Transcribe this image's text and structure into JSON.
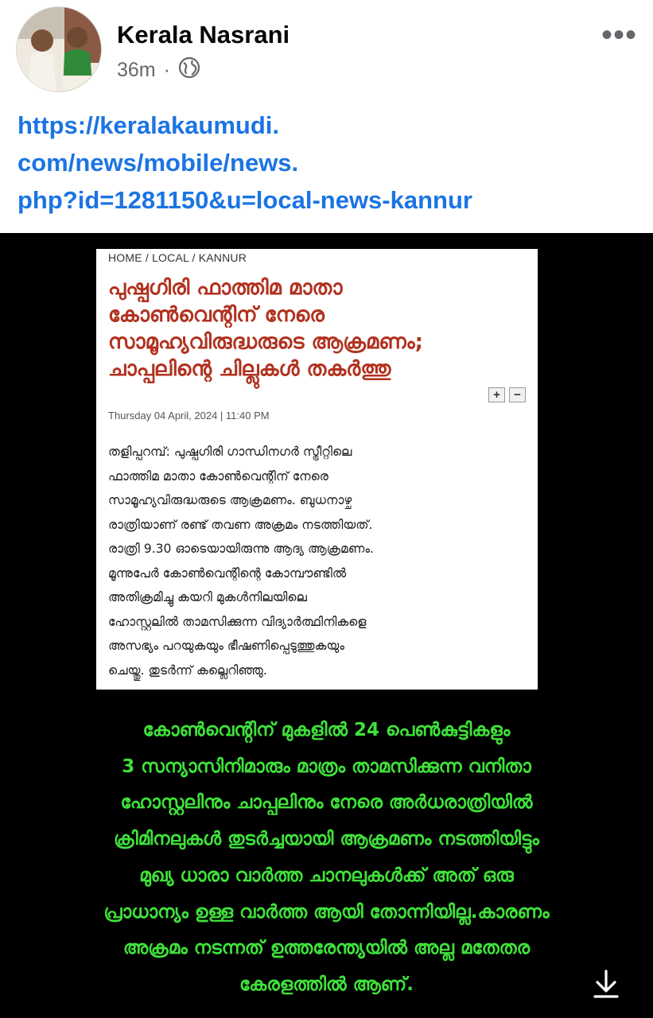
{
  "post": {
    "author": "Kerala Nasrani",
    "time": "36m",
    "separator": "·",
    "more_icon": "more-horizontal-icon",
    "privacy_icon": "globe-icon",
    "link_lines": [
      "https://keralakaumudi.",
      "com/news/mobile/news.",
      "php?id=1281150&u=local-news-kannur"
    ]
  },
  "article": {
    "breadcrumb": "HOME / LOCAL / KANNUR",
    "headline_lines": [
      "പുഷ്പഗിരി ഫാത്തിമ മാതാ",
      "കോൺവെന്റിന് നേരെ",
      "സാമൂഹ്യവിരുദ്ധരുടെ ആക്രമണം;",
      "ചാപ്പലിന്റെ ചില്ലുകൾ തകർത്തു"
    ],
    "zoom_in": "+",
    "zoom_out": "−",
    "dateline": "Thursday 04 April, 2024 | 11:40 PM",
    "body_lines": [
      "തളിപ്പറമ്പ്: പുഷ്പഗിരി ഗാന്ധിനഗർ സ്ട്രീറ്റിലെ",
      "ഫാത്തിമ മാതാ കോൺവെന്റിന് നേരെ",
      "സാമൂഹ്യവിരുദ്ധരുടെ ആക്രമണം. ബുധനാഴ്ച",
      "രാത്രിയാണ് രണ്ട് തവണ അക്രമം നടത്തിയത്.",
      "രാത്രി 9.30 ഓടെയായിരുന്നു ആദ്യ ആക്രമണം.",
      "മൂന്നുപേർ കോൺവെന്റിന്റെ കോമ്പൗണ്ടിൽ",
      "അതിക്രമിച്ചു കയറി മുകൾനിലയിലെ",
      "ഹോസ്റ്റലിൽ താമസിക്കുന്ന വിദ്യാർത്ഥിനികളെ",
      "അസഭ്യം പറയുകയും ഭീഷണിപ്പെടുത്തുകയും",
      "ചെയ്തു. തുടർന്ന് കല്ലെറിഞ്ഞു."
    ]
  },
  "caption_lines": [
    "കോൺവെൻ്റിന് മുകളിൽ 24 പെൺകുട്ടികളും",
    "3  സന്യാസിനിമാരും മാത്രം താമസിക്കുന്ന  വനിതാ",
    "ഹോസ്റ്റലിനും  ചാപ്പലിനും നേരെ അർധരാത്രിയിൽ",
    "ക്രിമിനലുകൾ തുടർച്ചയായി ആക്രമണം നടത്തിയിട്ടും",
    "മുഖ്യ ധാരാ വാർത്ത ചാനലുകൾക്ക് അത് ഒരു",
    "പ്രാധാന്യം ഉള്ള വാർത്ത ആയി തോന്നിയില്ല.കാരണം",
    "അക്രമം നടന്നത് ഉത്തരേന്ത്യയിൽ അല്ല മതേതര",
    "കേരളത്തിൽ ആണ്."
  ],
  "colors": {
    "link": "#1b74e4",
    "headline": "#b1321f",
    "caption": "#3fe23a",
    "media_background": "#000000"
  },
  "download_icon": "download-icon"
}
